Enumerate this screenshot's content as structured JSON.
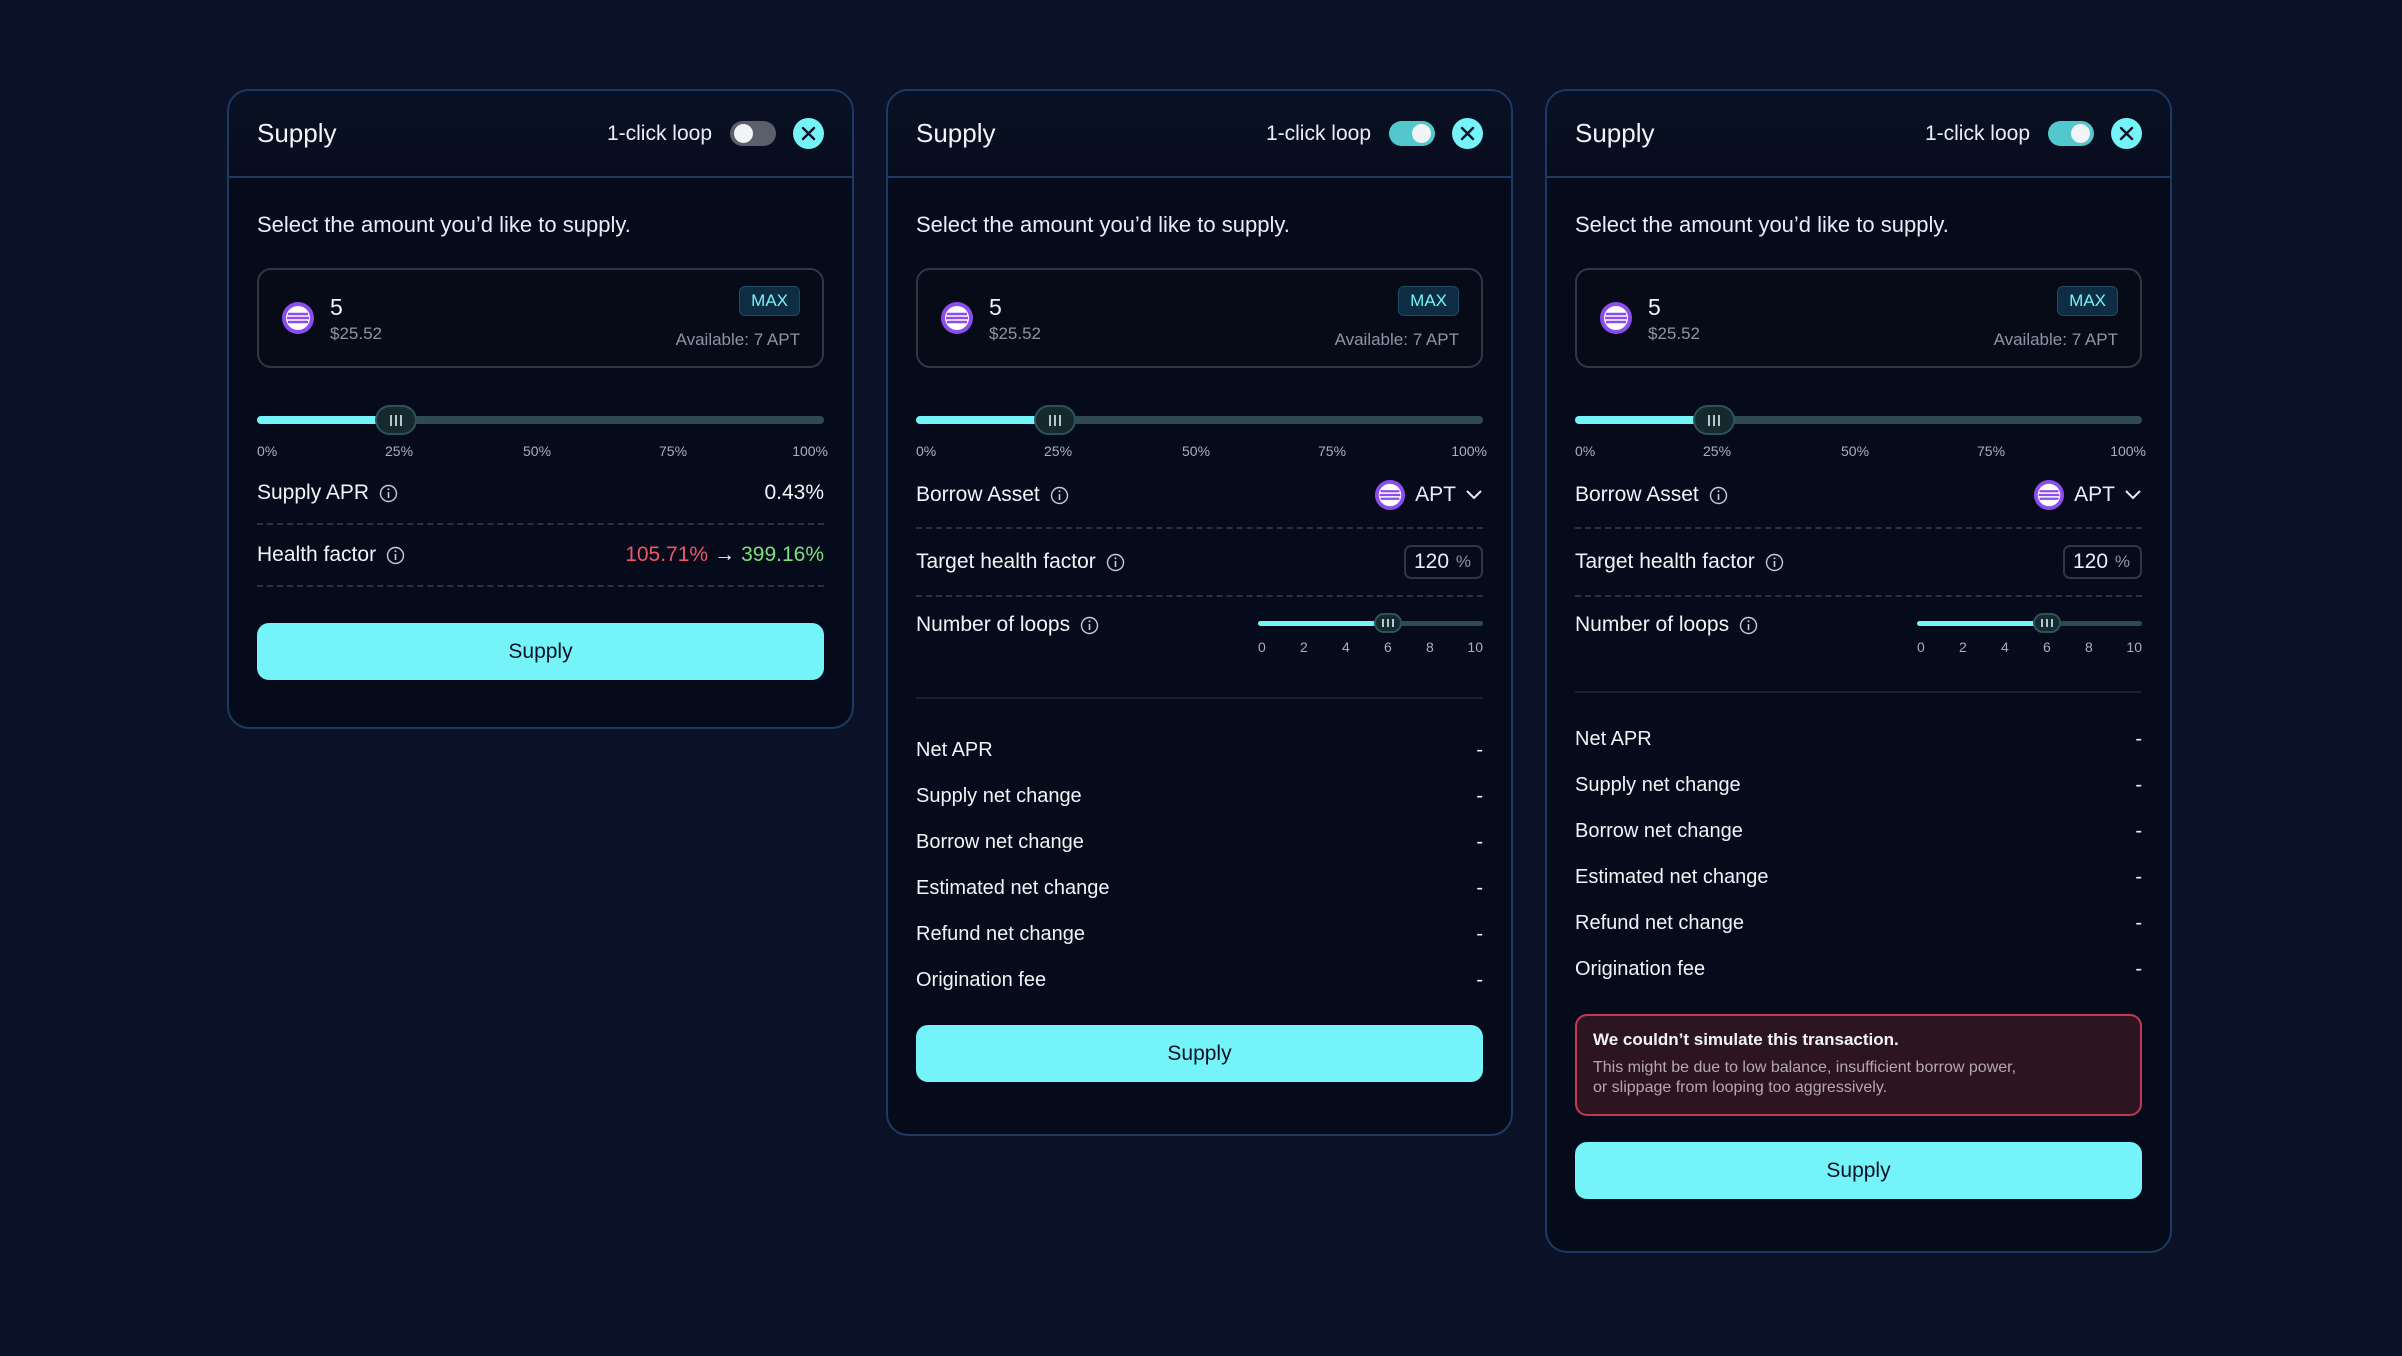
{
  "panels": [
    {
      "title": "Supply",
      "loop_label": "1-click loop",
      "loop_enabled": false,
      "instruction": "Select the amount you’d like to supply.",
      "amount": "5",
      "amount_usd": "$25.52",
      "max_label": "MAX",
      "available": "Available: 7 APT",
      "slider_percent": 25,
      "slider_ticks": [
        "0%",
        "25%",
        "50%",
        "75%",
        "100%"
      ],
      "supply_apr_label": "Supply APR",
      "supply_apr_value": "0.43%",
      "health_factor_label": "Health factor",
      "health_factor_old": "105.71%",
      "health_factor_new": "399.16%",
      "button_label": "Supply"
    },
    {
      "title": "Supply",
      "loop_label": "1-click loop",
      "loop_enabled": true,
      "instruction": "Select the amount you’d like to supply.",
      "amount": "5",
      "amount_usd": "$25.52",
      "max_label": "MAX",
      "available": "Available: 7 APT",
      "slider_percent": 25,
      "slider_ticks": [
        "0%",
        "25%",
        "50%",
        "75%",
        "100%"
      ],
      "borrow_asset_label": "Borrow Asset",
      "borrow_asset_value": "APT",
      "target_hf_label": "Target health factor",
      "target_hf_value": "120",
      "target_hf_unit": "%",
      "loops_label": "Number of loops",
      "loops_value": 6,
      "loops_ticks": [
        "0",
        "2",
        "4",
        "6",
        "8",
        "10"
      ],
      "summary": [
        {
          "label": "Net APR",
          "value": "-"
        },
        {
          "label": "Supply net change",
          "value": "-"
        },
        {
          "label": "Borrow net change",
          "value": "-"
        },
        {
          "label": "Estimated net change",
          "value": "-"
        },
        {
          "label": "Refund net change",
          "value": "-"
        },
        {
          "label": "Origination fee",
          "value": "-"
        }
      ],
      "button_label": "Supply"
    },
    {
      "title": "Supply",
      "loop_label": "1-click loop",
      "loop_enabled": true,
      "instruction": "Select the amount you’d like to supply.",
      "amount": "5",
      "amount_usd": "$25.52",
      "max_label": "MAX",
      "available": "Available: 7 APT",
      "slider_percent": 25,
      "slider_ticks": [
        "0%",
        "25%",
        "50%",
        "75%",
        "100%"
      ],
      "borrow_asset_label": "Borrow Asset",
      "borrow_asset_value": "APT",
      "target_hf_label": "Target health factor",
      "target_hf_value": "120",
      "target_hf_unit": "%",
      "loops_label": "Number of loops",
      "loops_value": 6,
      "loops_ticks": [
        "0",
        "2",
        "4",
        "6",
        "8",
        "10"
      ],
      "summary": [
        {
          "label": "Net APR",
          "value": "-"
        },
        {
          "label": "Supply net change",
          "value": "-"
        },
        {
          "label": "Borrow net change",
          "value": "-"
        },
        {
          "label": "Estimated net change",
          "value": "-"
        },
        {
          "label": "Refund net change",
          "value": "-"
        },
        {
          "label": "Origination fee",
          "value": "-"
        }
      ],
      "error_title": "We couldn’t simulate this transaction.",
      "error_text": "This might be due to low balance, insufficient borrow power, or slippage from looping too aggressively.",
      "button_label": "Supply"
    }
  ],
  "icons": {
    "token": "aptos-token-icon",
    "close": "close-icon",
    "info": "info-icon",
    "chevron": "chevron-down-icon"
  },
  "colors": {
    "background": "#0b1127",
    "accent": "#74f4f8",
    "health_bad": "#f0566a",
    "health_good": "#7de07e",
    "error_border": "#c23a51"
  }
}
